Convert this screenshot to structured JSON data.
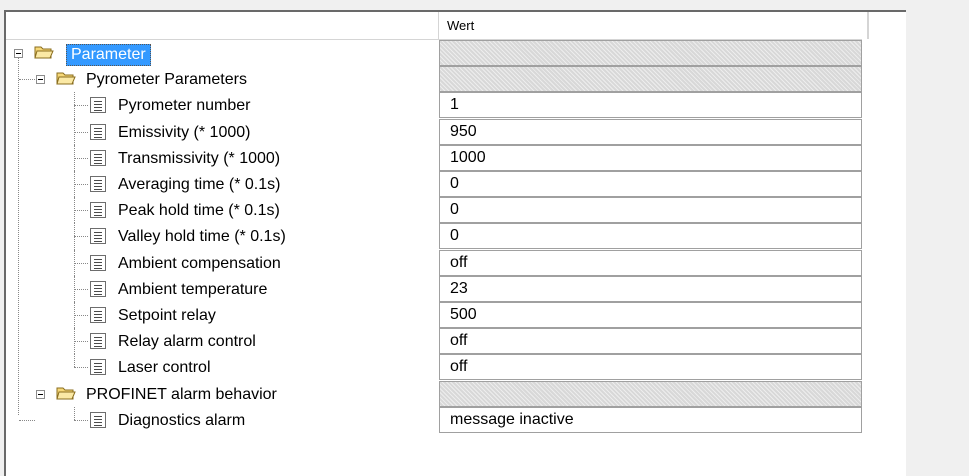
{
  "header": {
    "value_column": "Wert"
  },
  "tree": {
    "root": {
      "label": "Parameter"
    },
    "groups": [
      {
        "label": "Pyrometer Parameters",
        "items": [
          {
            "label": "Pyrometer number",
            "value": "1"
          },
          {
            "label": "Emissivity (* 1000)",
            "value": "950"
          },
          {
            "label": "Transmissivity (* 1000)",
            "value": "1000"
          },
          {
            "label": "Averaging time (* 0.1s)",
            "value": "0"
          },
          {
            "label": "Peak hold time (* 0.1s)",
            "value": "0"
          },
          {
            "label": "Valley hold time (* 0.1s)",
            "value": "0"
          },
          {
            "label": "Ambient compensation",
            "value": "off"
          },
          {
            "label": "Ambient temperature",
            "value": "23"
          },
          {
            "label": "Setpoint relay",
            "value": "500"
          },
          {
            "label": "Relay alarm control",
            "value": "off"
          },
          {
            "label": "Laser control",
            "value": "off"
          }
        ]
      },
      {
        "label": "PROFINET alarm behavior",
        "items": [
          {
            "label": "Diagnostics alarm",
            "value": "message inactive"
          }
        ]
      }
    ]
  },
  "colors": {
    "selection": "#3399ff",
    "group_cell": "#d8d8d8"
  },
  "icons": {
    "folder": "open-folder-icon",
    "parameter": "parameter-icon",
    "expander": "collapse-minus-icon"
  }
}
